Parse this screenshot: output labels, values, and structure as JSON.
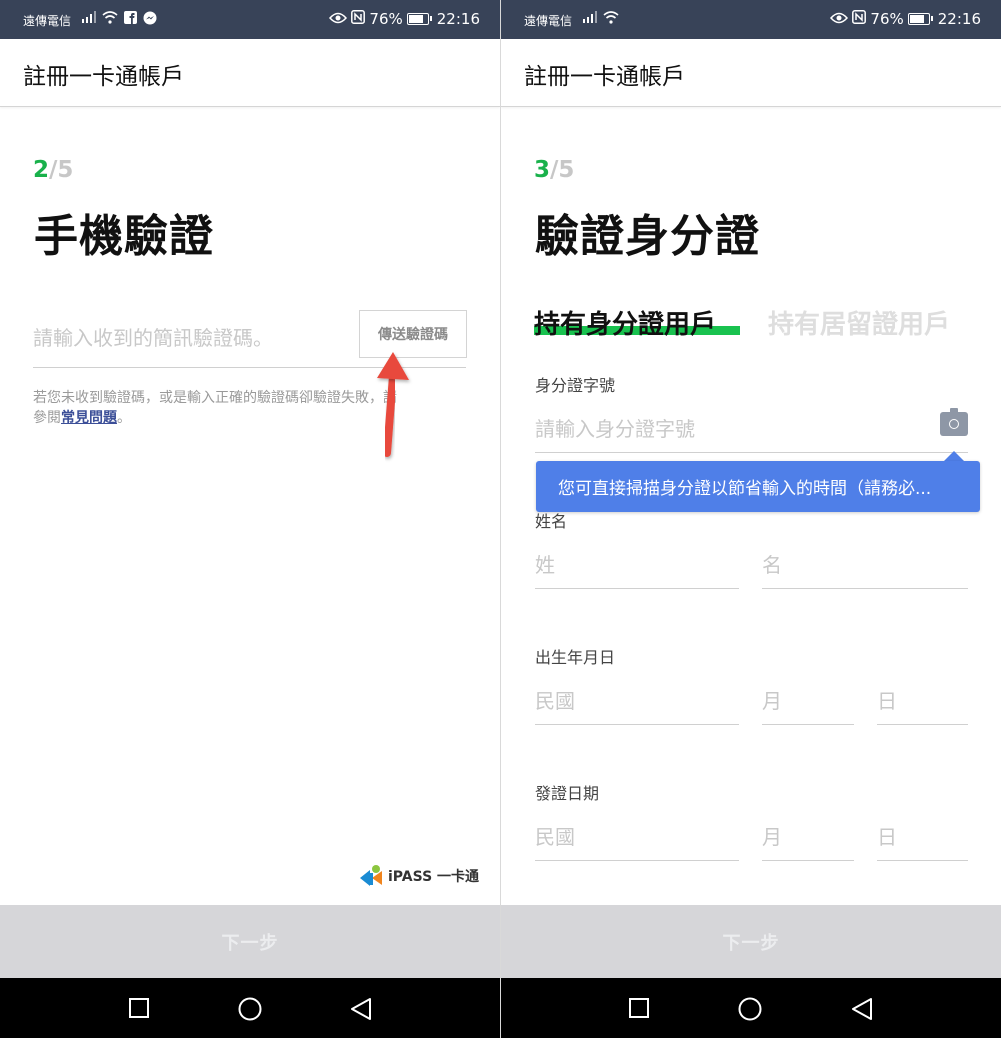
{
  "status_bar": {
    "carrier": "遠傳電信",
    "battery": "76%",
    "time": "22:16"
  },
  "app_bar": {
    "title": "註冊一卡通帳戶"
  },
  "left": {
    "step_current": "2",
    "step_rest": "/5",
    "heading": "手機驗證",
    "code_placeholder": "請輸入收到的簡訊驗證碼。",
    "send_button": "傳送驗證碼",
    "help_line1": "若您未收到驗證碼，或是輸入正確的驗證碼卻驗證失敗，請",
    "help_prefix": "參閱",
    "help_link": "常見問題",
    "help_suffix": "。",
    "logo_text": "iPASS 一卡通",
    "next_button": "下一步"
  },
  "right": {
    "step_current": "3",
    "step_rest": "/5",
    "heading": "驗證身分證",
    "tab_active": "持有身分證用戶",
    "tab_inactive": "持有居留證用戶",
    "id_label": "身分證字號",
    "id_placeholder": "請輸入身分證字號",
    "tooltip": "您可直接掃描身分證以節省輸入的時間（請務必...",
    "name_label": "姓名",
    "surname_placeholder": "姓",
    "given_placeholder": "名",
    "birth_label": "出生年月日",
    "issue_label": "發證日期",
    "year_placeholder": "民國",
    "month_placeholder": "月",
    "day_placeholder": "日",
    "next_button": "下一步"
  },
  "colors": {
    "accent_green": "#19b14b",
    "status_bar": "#384358",
    "tooltip_blue": "#4f7fe8",
    "arrow_red": "#e84a3c"
  }
}
